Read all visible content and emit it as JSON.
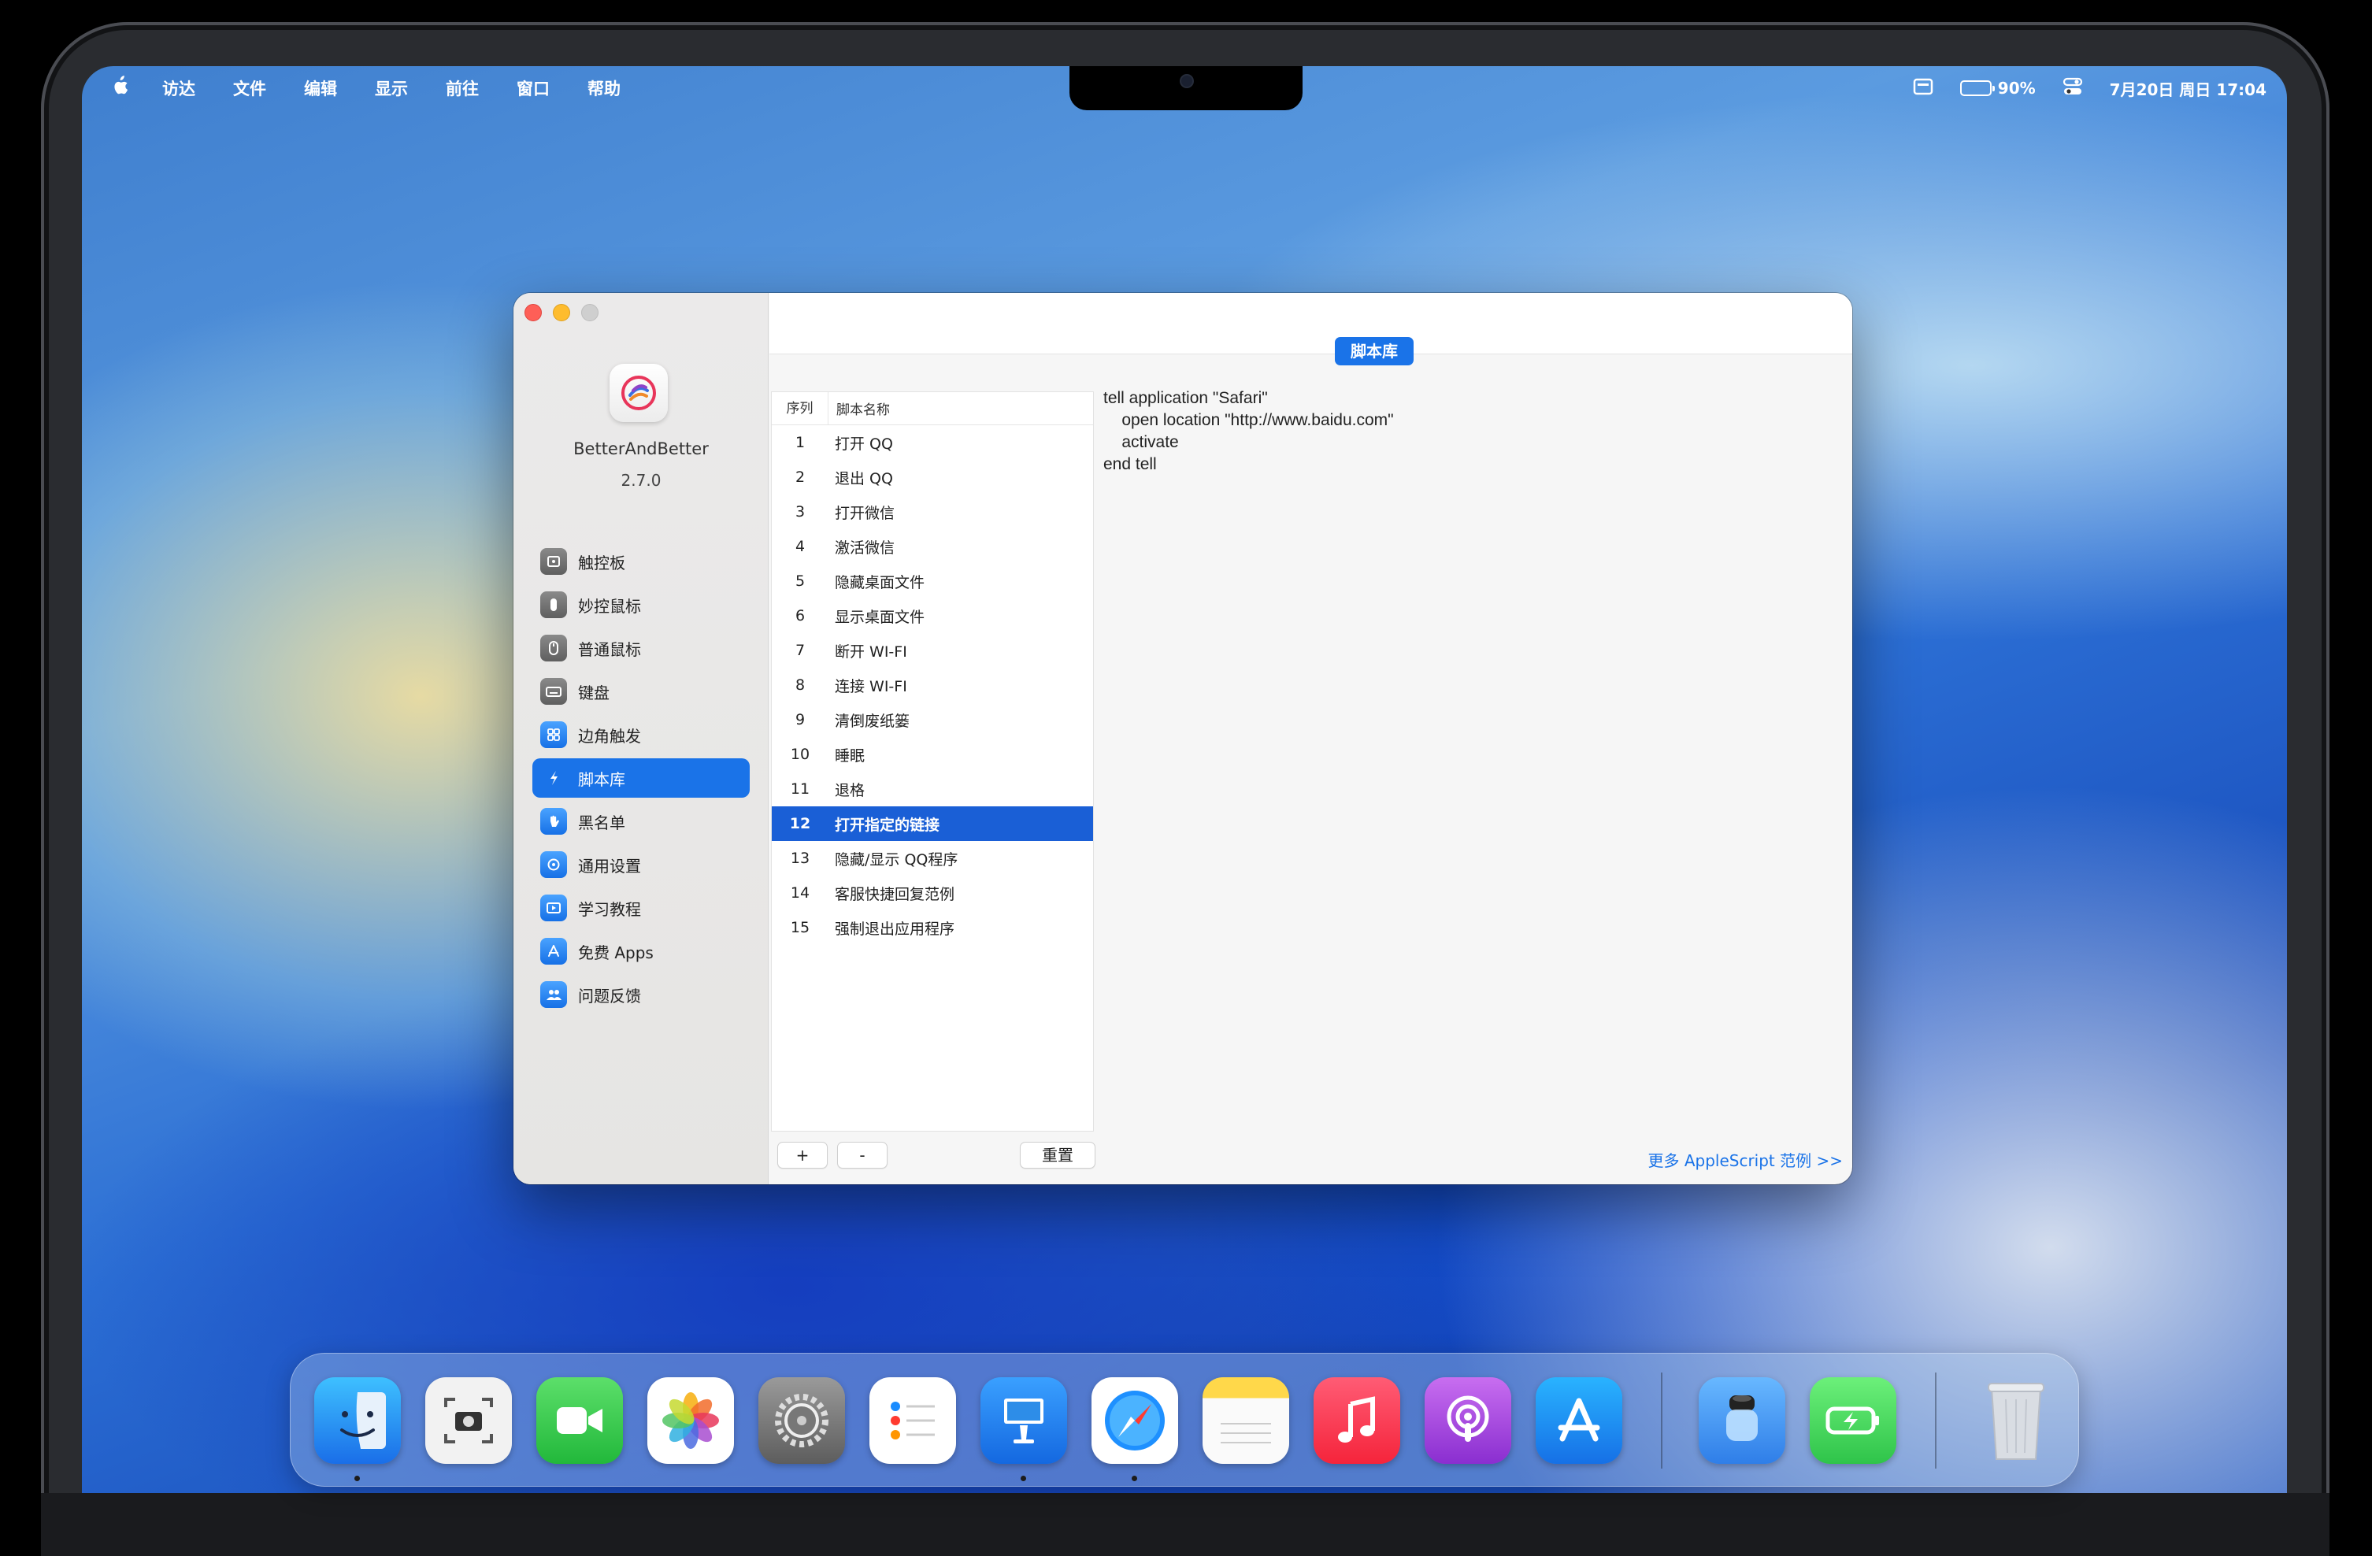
{
  "menubar": {
    "apple_icon": "apple-logo-icon",
    "items": [
      "访达",
      "文件",
      "编辑",
      "显示",
      "前往",
      "窗口",
      "帮助"
    ],
    "battery_percent": "90%",
    "datetime": "7月20日 周日 17:04"
  },
  "app": {
    "name": "BetterAndBetter",
    "version": "2.7.0",
    "sidebar": [
      {
        "label": "触控板",
        "icon": "trackpad-icon",
        "active": false
      },
      {
        "label": "妙控鼠标",
        "icon": "magic-mouse-icon",
        "active": false
      },
      {
        "label": "普通鼠标",
        "icon": "mouse-icon",
        "active": false
      },
      {
        "label": "键盘",
        "icon": "keyboard-icon",
        "active": false
      },
      {
        "label": "边角触发",
        "icon": "hot-corner-icon",
        "active": false
      },
      {
        "label": "脚本库",
        "icon": "script-icon",
        "active": true
      },
      {
        "label": "黑名单",
        "icon": "hand-block-icon",
        "active": false
      },
      {
        "label": "通用设置",
        "icon": "settings-icon",
        "active": false
      },
      {
        "label": "学习教程",
        "icon": "play-tutorial-icon",
        "active": false
      },
      {
        "label": "免费 Apps",
        "icon": "app-store-icon",
        "active": false
      },
      {
        "label": "问题反馈",
        "icon": "feedback-icon",
        "active": false
      }
    ],
    "tab_title": "脚本库",
    "table": {
      "headers": {
        "index": "序列",
        "name": "脚本名称"
      },
      "rows": [
        {
          "index": "1",
          "name": "打开 QQ"
        },
        {
          "index": "2",
          "name": "退出 QQ"
        },
        {
          "index": "3",
          "name": "打开微信"
        },
        {
          "index": "4",
          "name": "激活微信"
        },
        {
          "index": "5",
          "name": "隐藏桌面文件"
        },
        {
          "index": "6",
          "name": "显示桌面文件"
        },
        {
          "index": "7",
          "name": "断开 WI-FI"
        },
        {
          "index": "8",
          "name": "连接 WI-FI"
        },
        {
          "index": "9",
          "name": "清倒废纸篓"
        },
        {
          "index": "10",
          "name": "睡眠"
        },
        {
          "index": "11",
          "name": "退格"
        },
        {
          "index": "12",
          "name": "打开指定的链接"
        },
        {
          "index": "13",
          "name": "隐藏/显示 QQ程序"
        },
        {
          "index": "14",
          "name": "客服快捷回复范例"
        },
        {
          "index": "15",
          "name": "强制退出应用程序"
        }
      ],
      "selected_index": "12"
    },
    "buttons": {
      "add": "+",
      "remove": "-",
      "reset": "重置"
    },
    "code_lines": [
      "tell application \"Safari\"",
      "    open location \"http://www.baidu.com\"",
      "    activate",
      "end tell"
    ],
    "more_link": "更多 AppleScript 范例 >>"
  },
  "dock": {
    "apps": [
      {
        "name": "finder-icon",
        "running": true
      },
      {
        "name": "screenshot-icon",
        "running": false
      },
      {
        "name": "facetime-icon",
        "running": false
      },
      {
        "name": "photos-icon",
        "running": false
      },
      {
        "name": "system-settings-icon",
        "running": false
      },
      {
        "name": "reminders-icon",
        "running": false
      },
      {
        "name": "keynote-icon",
        "running": true
      },
      {
        "name": "safari-icon",
        "running": true
      },
      {
        "name": "notes-icon",
        "running": false
      },
      {
        "name": "music-icon",
        "running": false
      },
      {
        "name": "podcasts-icon",
        "running": false
      },
      {
        "name": "app-store-icon",
        "running": false
      },
      {
        "name": "camera-app-icon",
        "running": false
      },
      {
        "name": "battery-app-icon",
        "running": false
      },
      {
        "name": "trash-icon",
        "running": false
      }
    ]
  }
}
